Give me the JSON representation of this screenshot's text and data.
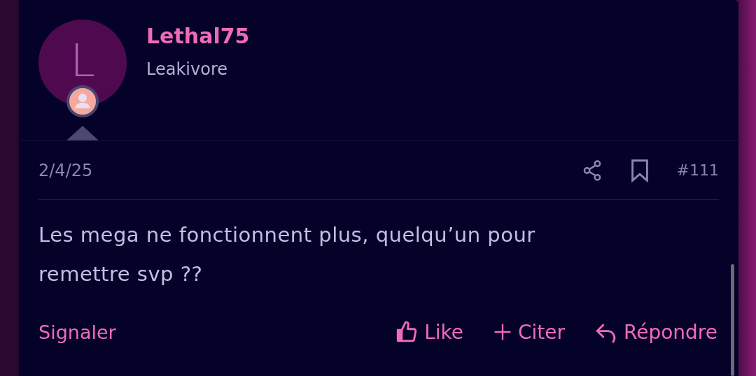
{
  "post": {
    "avatar_letter": "L",
    "username": "Lethal75",
    "user_title": "Leakivore",
    "date": "2/4/25",
    "post_number": "#111",
    "message": "Les mega ne fonctionnent plus, quelqu’un pour remettre svp ??",
    "report": "Signaler",
    "actions": [
      {
        "kind": "like",
        "label": "Like"
      },
      {
        "kind": "quote",
        "label": "Citer"
      },
      {
        "kind": "reply",
        "label": "Répondre"
      }
    ]
  }
}
